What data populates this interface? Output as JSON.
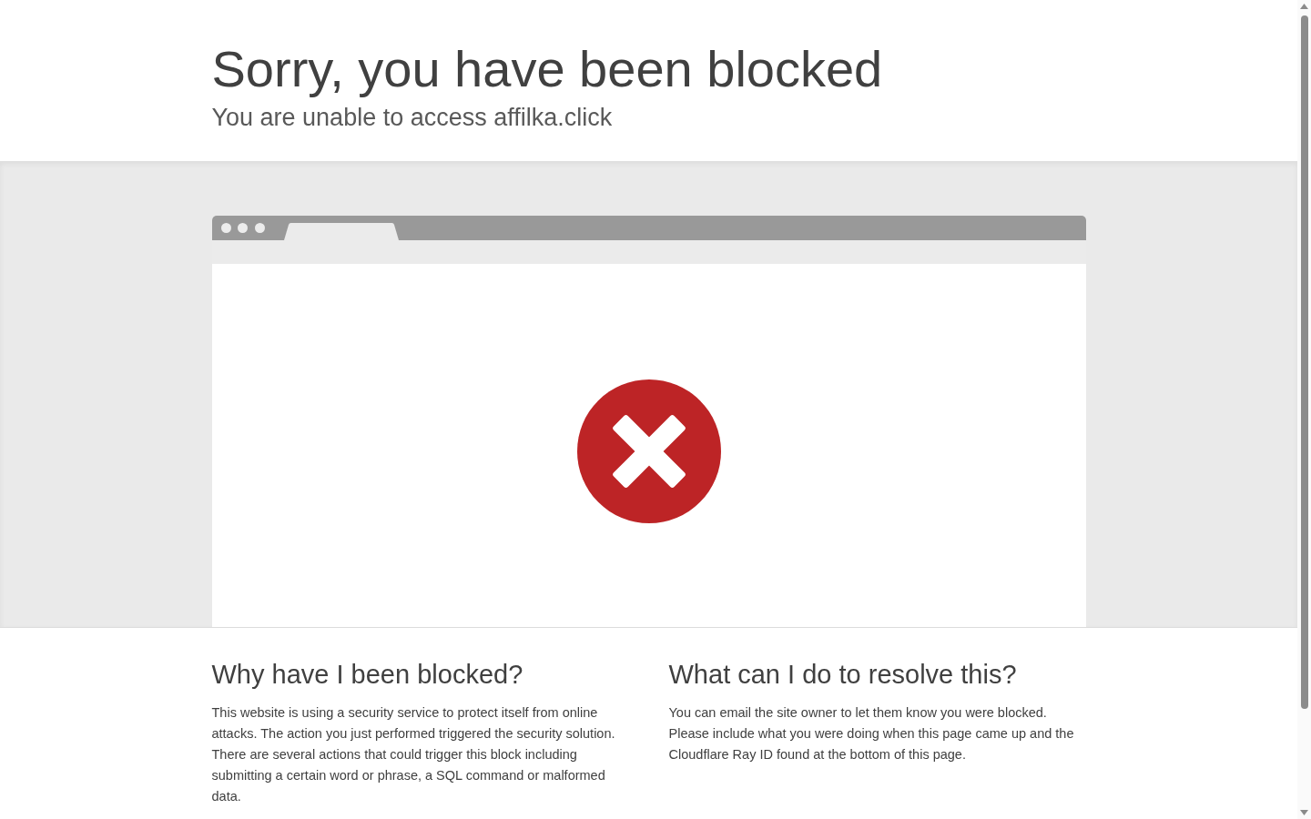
{
  "header": {
    "title": "Sorry, you have been blocked",
    "subtitle": "You are unable to access affilka.click"
  },
  "sections": [
    {
      "heading": "Why have I been blocked?",
      "body": "This website is using a security service to protect itself from online attacks. The action you just performed triggered the security solution. There are several actions that could trigger this block including submitting a certain word or phrase, a SQL command or malformed data."
    },
    {
      "heading": "What can I do to resolve this?",
      "body": "You can email the site owner to let them know you were blocked. Please include what you were doing when this page came up and the Cloudflare Ray ID found at the bottom of this page."
    }
  ]
}
